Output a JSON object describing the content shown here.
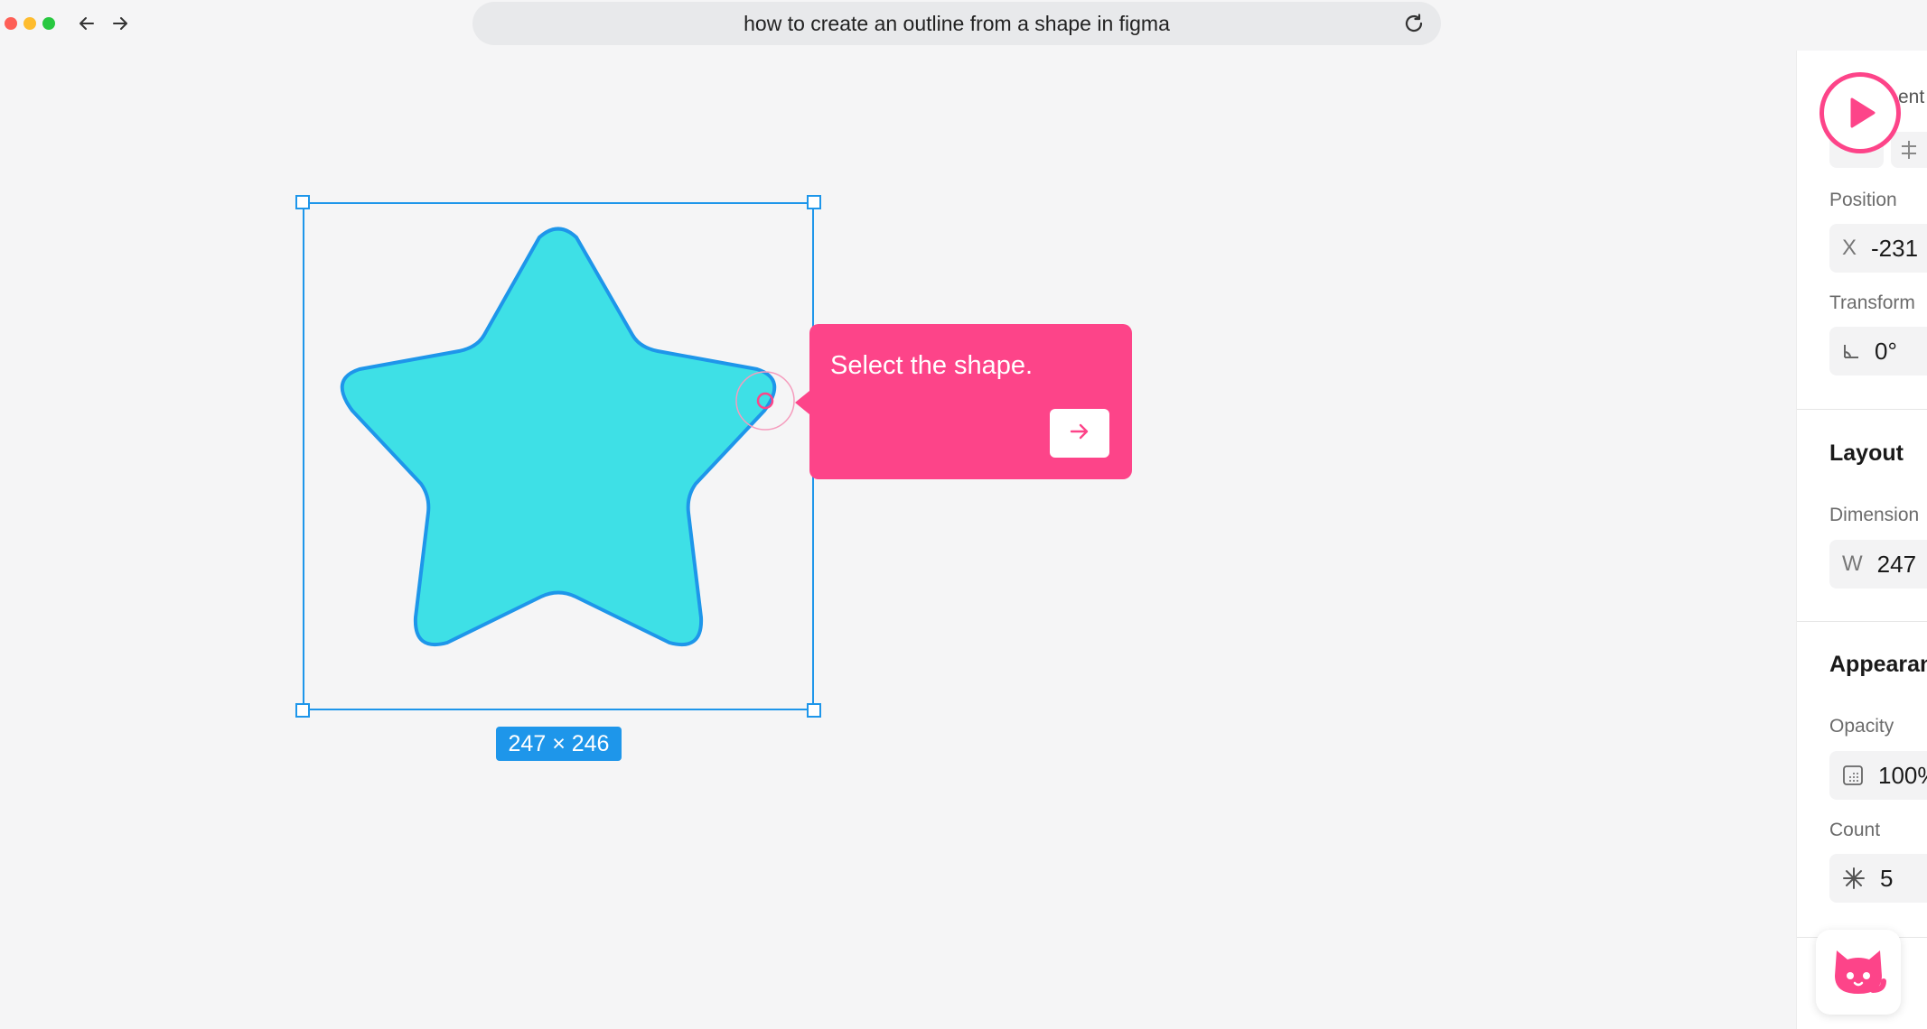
{
  "browser": {
    "url_text": "how to create an outline from a shape in figma",
    "icons": [
      "back-arrow-icon",
      "forward-arrow-icon",
      "reload-icon"
    ]
  },
  "canvas": {
    "shape": "star",
    "shape_fill": "#3ee0e6",
    "shape_stroke": "#1e96ea",
    "selection_color": "#1e96ea",
    "dimension_label": "247 × 246"
  },
  "tooltip": {
    "text": "Select the shape.",
    "color": "#fd4489",
    "next_icon": "arrow-right-icon"
  },
  "panel": {
    "top_partial_label": "ent",
    "position": {
      "label": "Position",
      "x_prefix": "X",
      "x_value": "-231"
    },
    "transform": {
      "label": "Transform",
      "rotation": "0°"
    },
    "layout": {
      "heading": "Layout",
      "dimensions_label": "Dimension",
      "w_prefix": "W",
      "w_value": "247"
    },
    "appearance": {
      "heading": "Appearan",
      "opacity_label": "Opacity",
      "opacity_value": "100%",
      "count_label": "Count",
      "count_value": "5"
    }
  }
}
